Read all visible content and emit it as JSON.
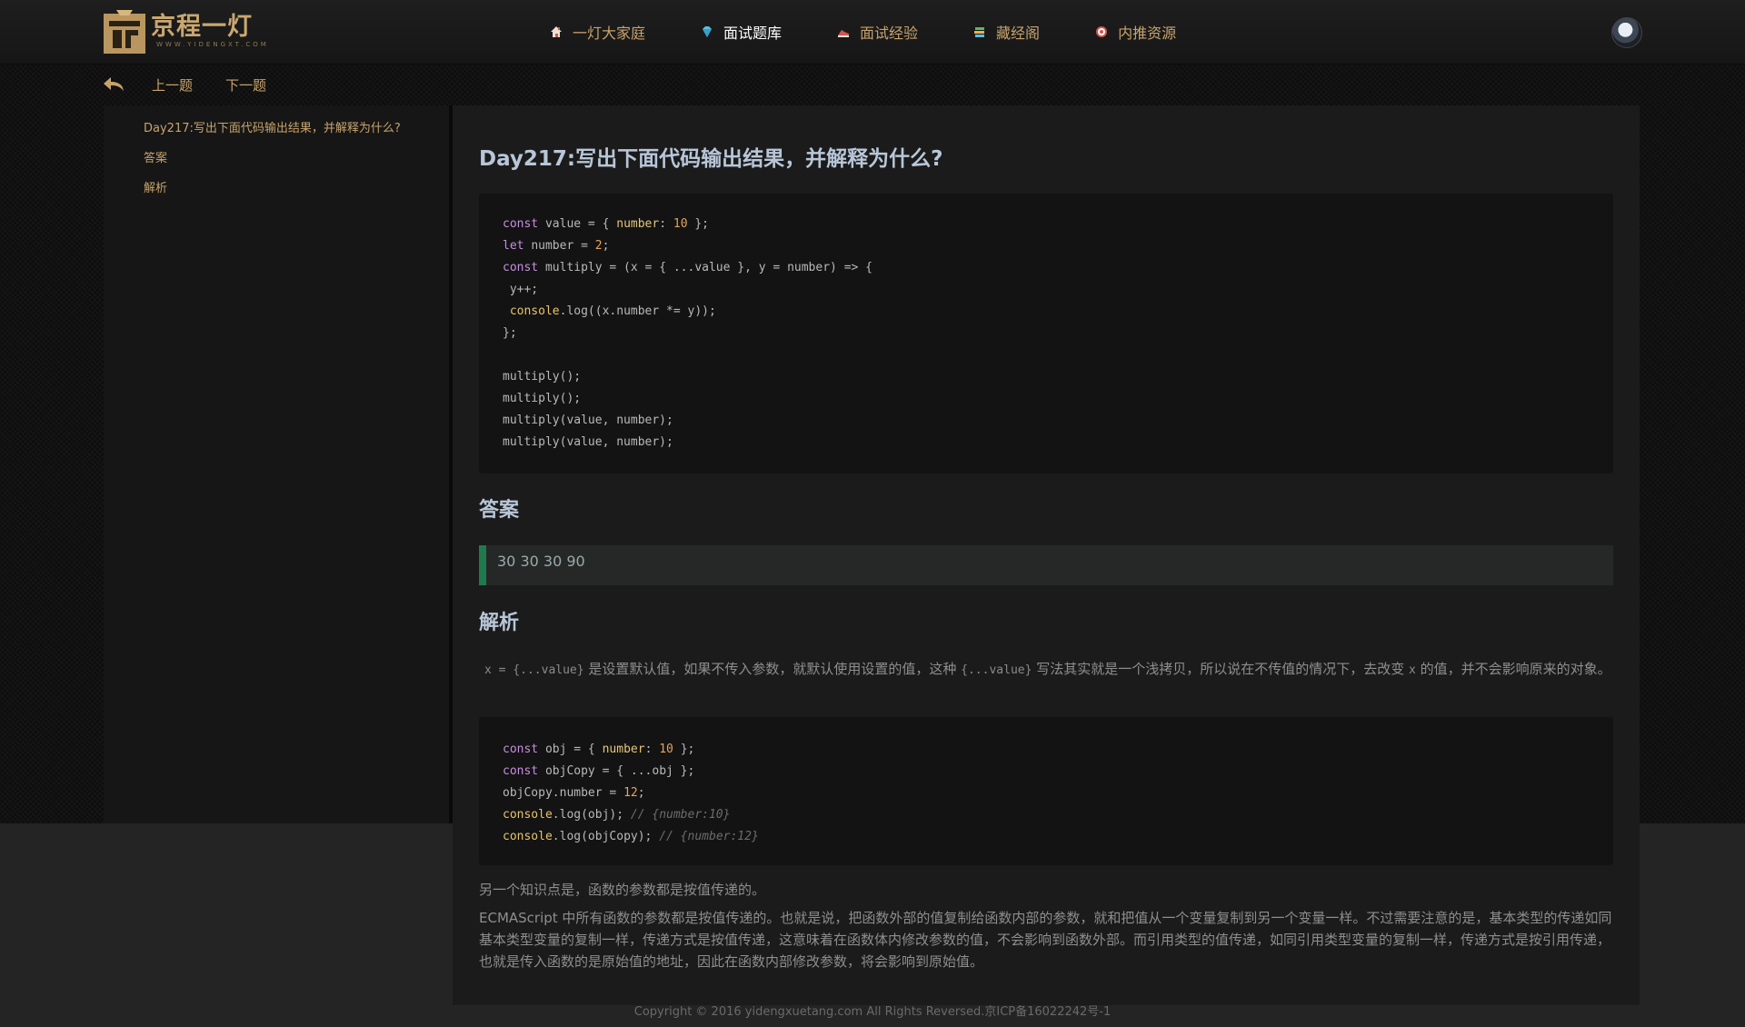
{
  "header": {
    "logo_name": "京程一灯",
    "logo_sub": "WWW.YIDENGXT.COM",
    "nav": [
      {
        "label": "一灯大家庭",
        "icon": "house-icon"
      },
      {
        "label": "面试题库",
        "icon": "diamond-icon"
      },
      {
        "label": "面试经验",
        "icon": "shoe-icon"
      },
      {
        "label": "藏经阁",
        "icon": "books-icon"
      },
      {
        "label": "内推资源",
        "icon": "target-icon"
      }
    ]
  },
  "subnav": {
    "prev": "上一题",
    "next": "下一题"
  },
  "toc": [
    "Day217:写出下面代码输出结果，并解释为什么?",
    "答案",
    "解析"
  ],
  "article": {
    "title": "Day217:写出下面代码输出结果，并解释为什么?",
    "answer_heading": "答案",
    "answer": "30 30 30 90",
    "analysis_heading": "解析",
    "analysis_p1_code1": "x = {...value}",
    "analysis_p1_text1": "是设置默认值，如果不传入参数，就默认使用设置的值，这种",
    "analysis_p1_code2": "{...value}",
    "analysis_p1_text2": "写法其实就是一个浅拷贝，所以说在不传值的情况下，去改变",
    "analysis_p1_code3": "x",
    "analysis_p1_text3": "的值，并不会影响原来的对象。",
    "analysis_p2": "另一个知识点是，函数的参数都是按值传递的。",
    "analysis_p3": "ECMAScript 中所有函数的参数都是按值传递的。也就是说，把函数外部的值复制给函数内部的参数，就和把值从一个变量复制到另一个变量一样。不过需要注意的是，基本类型的传递如同基本类型变量的复制一样，传递方式是按值传递，这意味着在函数体内修改参数的值，不会影响到函数外部。而引用类型的值传递，如同引用类型变量的复制一样，传递方式是按引用传递，也就是传入函数的是原始值的地址，因此在函数内部修改参数，将会影响到原始值。"
  },
  "code1": {
    "l1": [
      "const",
      "value = { ",
      "number",
      ": ",
      "10",
      " };"
    ],
    "l2": [
      "let",
      "number = ",
      "2",
      ";"
    ],
    "l3": [
      "const",
      "multiply = (x = { ...value }, y = number) => {"
    ],
    "l4": " y++;",
    "l5": [
      "console",
      ".log((x.number *= y));"
    ],
    "l6": "};",
    "l7": "multiply();",
    "l8": "multiply();",
    "l9": "multiply(value, number);",
    "l10": "multiply(value, number);"
  },
  "code2": {
    "l1": [
      "const",
      "obj = { ",
      "number",
      ": ",
      "10",
      " };"
    ],
    "l2": [
      "const",
      "objCopy = { ...obj };"
    ],
    "l3": [
      "objCopy.number = ",
      "12",
      ";"
    ],
    "l4": [
      "console",
      ".log(obj); ",
      "// {number:10}"
    ],
    "l5": [
      "console",
      ".log(objCopy); ",
      "// {number:12}"
    ]
  },
  "footer": "Copyright © 2016 yidengxuetang.com All Rights Reversed.京ICP备16022242号-1",
  "colors": {
    "accent_gold": "#c7a36c",
    "title": "#b8c6d8",
    "answer_bar": "#1f7a4e"
  }
}
